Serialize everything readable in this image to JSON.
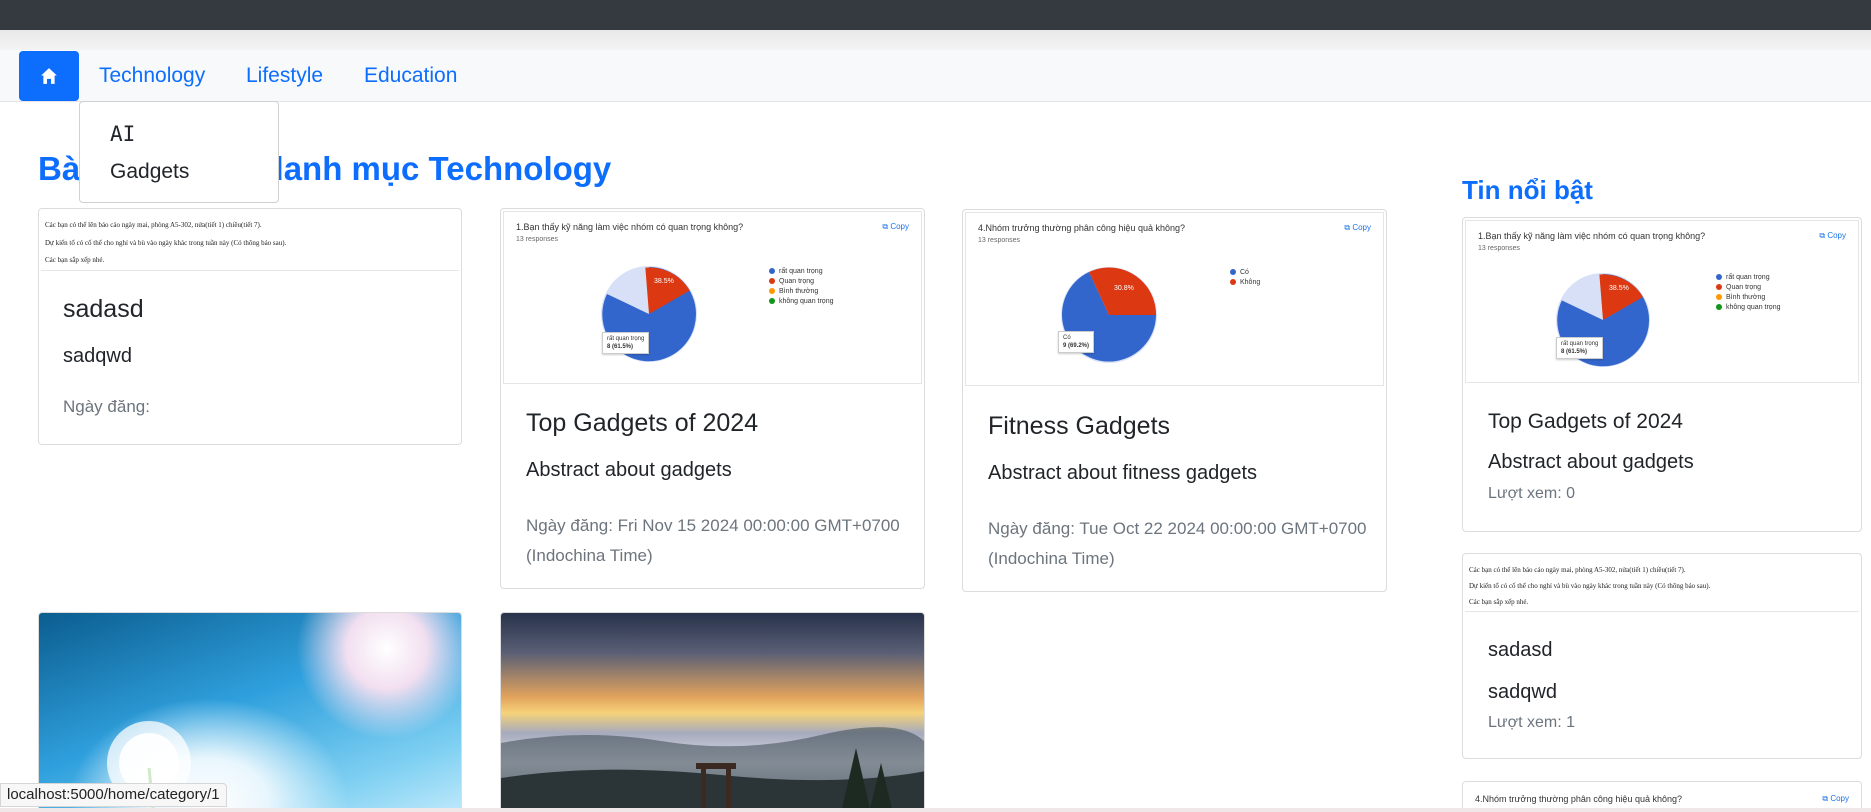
{
  "nav": {
    "home_icon": "house-icon",
    "items": [
      {
        "label": "Technology"
      },
      {
        "label": "Lifestyle"
      },
      {
        "label": "Education"
      }
    ],
    "dropdown": [
      {
        "label": "AI"
      },
      {
        "label": "Gadgets"
      }
    ]
  },
  "main": {
    "section_title": "Bài viết thuộc danh mục Technology",
    "cards": [
      {
        "doc_lines": [
          "Các bạn có thể lên báo cáo ngày mai, phòng A5-302, nửa(tiết 1) chiều(tiết 7).",
          "Dự kiến tổ có cố thể cho nghỉ và bù vào ngày khác trong tuần này (Có thông báo sau).",
          "Các bạn sắp xếp nhé."
        ],
        "title": "sadasd",
        "abstract": "sadqwd",
        "date": "Ngày đăng:"
      },
      {
        "shot": {
          "question": "1.Bạn thấy kỹ năng làm việc nhóm có quan trọng không?",
          "responses": "13 responses",
          "copy": "Copy",
          "legend": [
            "rất quan trọng",
            "Quan trọng",
            "Bình thường",
            "không quan trọng"
          ],
          "slice_label": "38.5%",
          "tooltip_a": "rất quan trọng",
          "tooltip_b": "8 (61.5%)"
        },
        "title": "Top Gadgets of 2024",
        "abstract": "Abstract about gadgets",
        "date": "Ngày đăng: Fri Nov 15 2024 00:00:00 GMT+0700 (Indochina Time)"
      },
      {
        "shot": {
          "question": "4.Nhóm trưởng thường phân công hiệu quả không?",
          "responses": "13 responses",
          "copy": "Copy",
          "legend": [
            "Có",
            "Không"
          ],
          "slice_label": "30.8%",
          "tooltip_a": "Có",
          "tooltip_b": "9 (69.2%)"
        },
        "title": "Fitness Gadgets",
        "abstract": "Abstract about fitness gadgets",
        "date": "Ngày đăng: Tue Oct 22 2024 00:00:00 GMT+0700 (Indochina Time)"
      }
    ]
  },
  "sidebar": {
    "title": "Tin nổi bật",
    "cards": [
      {
        "title": "Top Gadgets of 2024",
        "abstract": "Abstract about gadgets",
        "views": "Lượt xem: 0"
      },
      {
        "title": "sadasd",
        "abstract": "sadqwd",
        "views": "Lượt xem: 1"
      },
      {
        "question": "4.Nhóm trưởng thường phân công hiệu quả không?",
        "copy": "Copy"
      }
    ]
  },
  "statusbar": {
    "url": "localhost:5000/home/category/1"
  },
  "colors": {
    "primary": "#0d6efd",
    "pie_blue": "#3366cc",
    "pie_red": "#dc3912",
    "pie_orange": "#ff9900",
    "pie_green": "#109618"
  }
}
